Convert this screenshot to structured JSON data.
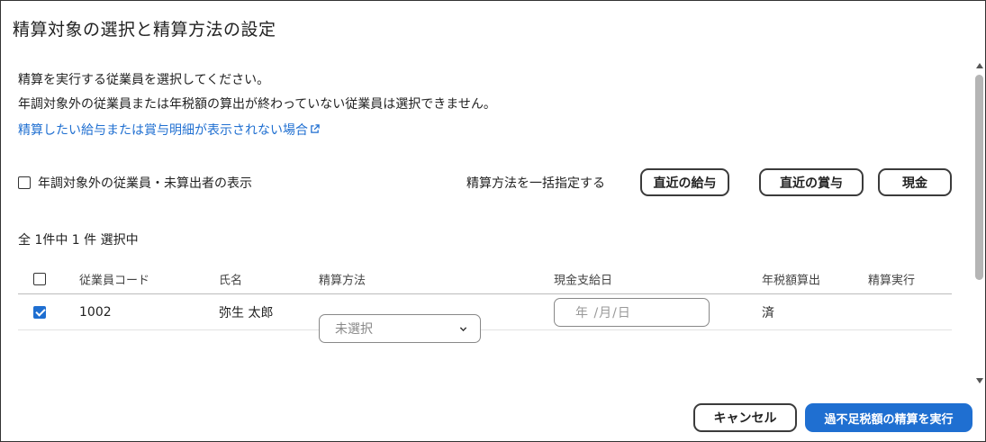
{
  "dialog": {
    "title": "精算対象の選択と精算方法の設定",
    "description_line1": "精算を実行する従業員を選択してください。",
    "description_line2": "年調対象外の従業員または年税額の算出が終わっていない従業員は選択できません。",
    "help_link": "精算したい給与または賞与明細が表示されない場合"
  },
  "options": {
    "show_excluded_label": "年調対象外の従業員・未算出者の表示",
    "show_excluded_checked": false
  },
  "bulk": {
    "label": "精算方法を一括指定する",
    "buttons": [
      "直近の給与",
      "直近の賞与",
      "現金"
    ]
  },
  "selection_count": "全 1件中 1 件 選択中",
  "table": {
    "columns": [
      "従業員コード",
      "氏名",
      "精算方法",
      "現金支給日",
      "年税額算出",
      "精算実行"
    ],
    "rows": [
      {
        "checked": true,
        "code": "1002",
        "name": "弥生 太郎",
        "method_placeholder": "未選択",
        "cash_date_placeholder": "年 /月/日",
        "tax_calculated": "済",
        "exec": ""
      }
    ]
  },
  "footer": {
    "cancel": "キャンセル",
    "primary": "過不足税額の精算を実行"
  },
  "colors": {
    "accent": "#1f6fd1",
    "border": "#3b3b3b"
  }
}
